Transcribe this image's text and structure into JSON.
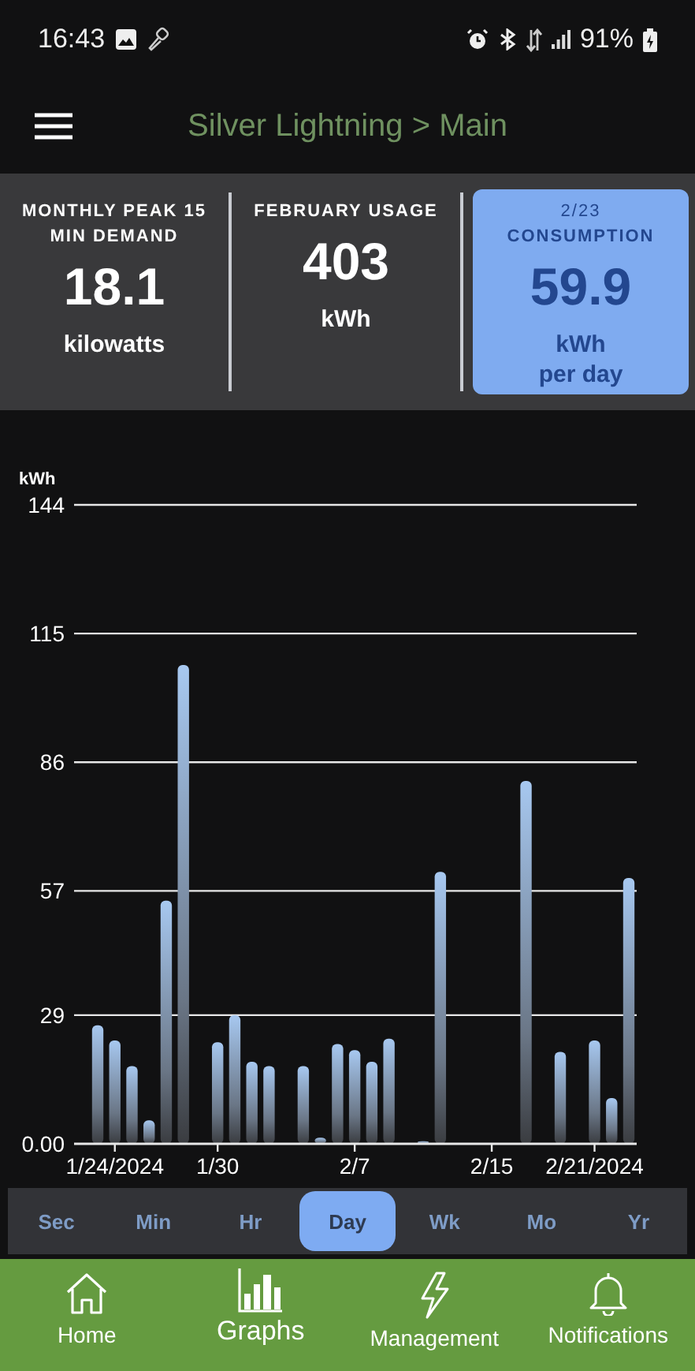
{
  "status_bar": {
    "time": "16:43",
    "battery": "91%"
  },
  "header": {
    "title": "Silver Lightning > Main"
  },
  "stats": [
    {
      "label": "MONTHLY PEAK 15 MIN DEMAND",
      "value": "18.1",
      "unit": "kilowatts",
      "selected": false
    },
    {
      "label": "FEBRUARY USAGE",
      "value": "403",
      "unit": "kWh",
      "selected": false
    },
    {
      "date": "2/23",
      "label": "CONSUMPTION",
      "value": "59.9",
      "unit": "kWh",
      "unit_note": "per day",
      "selected": true
    }
  ],
  "chart": {
    "chart_data": {
      "type": "bar",
      "ylabel": "kWh",
      "categories": [
        null,
        "1/24/2024",
        null,
        null,
        null,
        null,
        null,
        "1/30",
        null,
        null,
        null,
        null,
        null,
        null,
        null,
        "2/7",
        null,
        null,
        null,
        null,
        null,
        null,
        null,
        "2/15",
        null,
        null,
        null,
        null,
        null,
        "2/21/2024",
        null,
        null
      ],
      "grid": true,
      "values": [
        26.7,
        23.3,
        17.5,
        5.3,
        54.8,
        107.9,
        null,
        22.9,
        29.0,
        18.5,
        17.5,
        null,
        17.5,
        1.4,
        22.5,
        21.1,
        18.5,
        23.7,
        null,
        0.6,
        61.3,
        null,
        null,
        null,
        null,
        81.8,
        null,
        20.7,
        null,
        23.3,
        10.3,
        59.9
      ],
      "ylim": [
        0,
        144
      ],
      "yticks": [
        {
          "value": 0,
          "label": "0.00"
        },
        29,
        57,
        86,
        115,
        144
      ]
    }
  },
  "ranges": [
    {
      "label": "Sec",
      "selected": false
    },
    {
      "label": "Min",
      "selected": false
    },
    {
      "label": "Hr",
      "selected": false
    },
    {
      "label": "Day",
      "selected": true
    },
    {
      "label": "Wk",
      "selected": false
    },
    {
      "label": "Mo",
      "selected": false
    },
    {
      "label": "Yr",
      "selected": false
    }
  ],
  "nav": [
    {
      "label": "Home",
      "kind": "home",
      "selected": false
    },
    {
      "label": "Graphs",
      "kind": "graphs",
      "selected": true
    },
    {
      "label": "Management",
      "kind": "bolt",
      "selected": false
    },
    {
      "label": "Notifications",
      "kind": "bell",
      "selected": false
    }
  ]
}
